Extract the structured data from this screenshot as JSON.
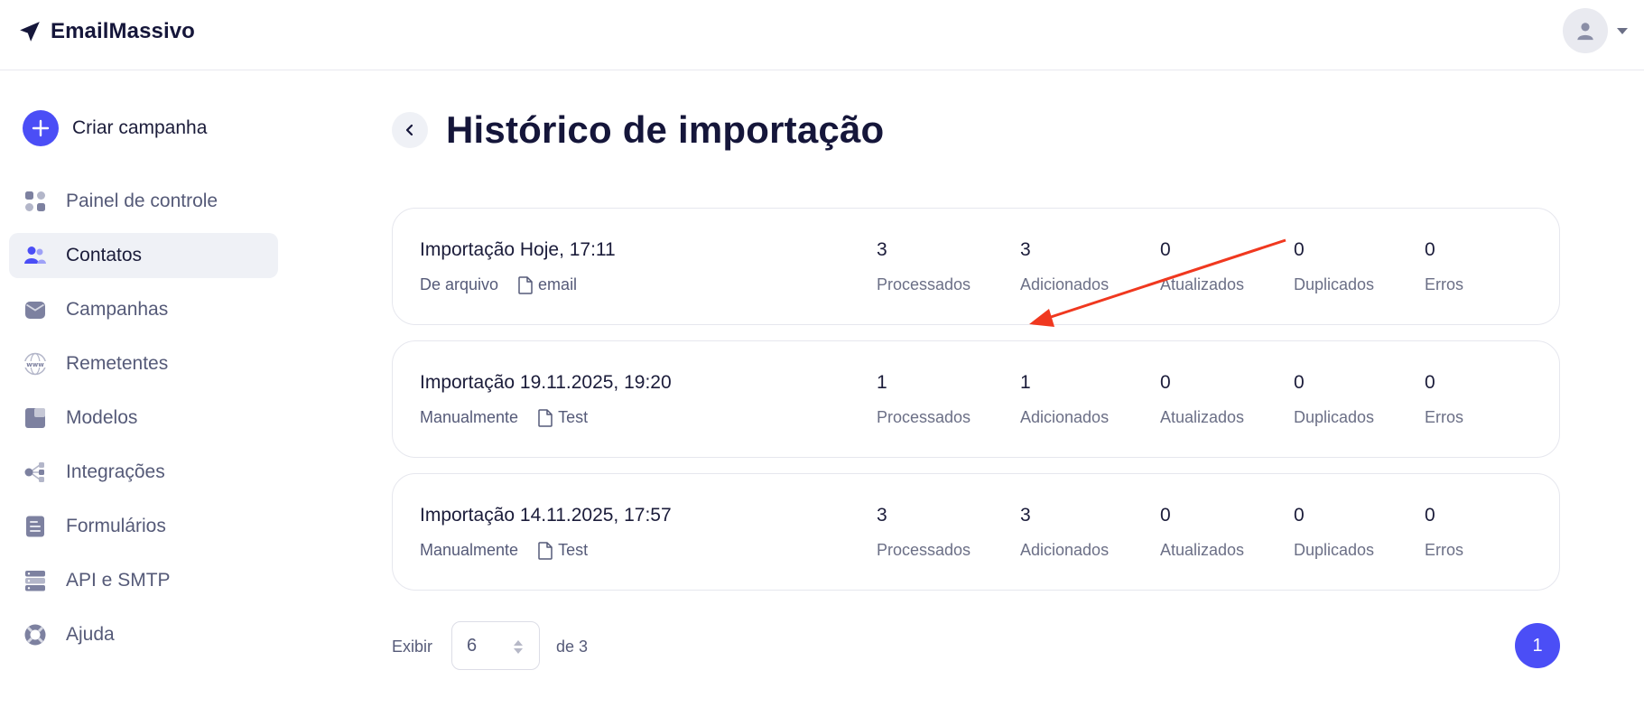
{
  "brand": {
    "name": "EmailMassivo",
    "icon": "paper-plane-icon"
  },
  "user": {
    "avatar_icon": "user-icon"
  },
  "sidebar": {
    "create_label": "Criar campanha",
    "items": [
      {
        "label": "Painel de controle",
        "icon": "dashboard-icon"
      },
      {
        "label": "Contatos",
        "icon": "contacts-icon",
        "active": true
      },
      {
        "label": "Campanhas",
        "icon": "campaigns-icon"
      },
      {
        "label": "Remetentes",
        "icon": "www-icon"
      },
      {
        "label": "Modelos",
        "icon": "templates-icon"
      },
      {
        "label": "Integrações",
        "icon": "integrations-icon"
      },
      {
        "label": "Formulários",
        "icon": "forms-icon"
      },
      {
        "label": "API e SMTP",
        "icon": "server-icon"
      },
      {
        "label": "Ajuda",
        "icon": "help-icon"
      }
    ]
  },
  "page": {
    "title": "Histórico de importação"
  },
  "stat_labels": [
    "Processados",
    "Adicionados",
    "Atualizados",
    "Duplicados",
    "Erros"
  ],
  "imports": [
    {
      "title": "Importação Hoje, 17:11",
      "source": "De arquivo",
      "file": "email",
      "stats": [
        "3",
        "3",
        "0",
        "0",
        "0"
      ]
    },
    {
      "title": "Importação 19.11.2025, 19:20",
      "source": "Manualmente",
      "file": "Test",
      "stats": [
        "1",
        "1",
        "0",
        "0",
        "0"
      ]
    },
    {
      "title": "Importação 14.11.2025, 17:57",
      "source": "Manualmente",
      "file": "Test",
      "stats": [
        "3",
        "3",
        "0",
        "0",
        "0"
      ]
    }
  ],
  "pagination": {
    "show_label": "Exibir",
    "per_page": "6",
    "of_label": "de 3",
    "current_page": "1"
  },
  "colors": {
    "accent": "#4b4ef6",
    "annotation_arrow": "#f0381f",
    "text_dark": "#15163a",
    "text_muted": "#555a78"
  }
}
